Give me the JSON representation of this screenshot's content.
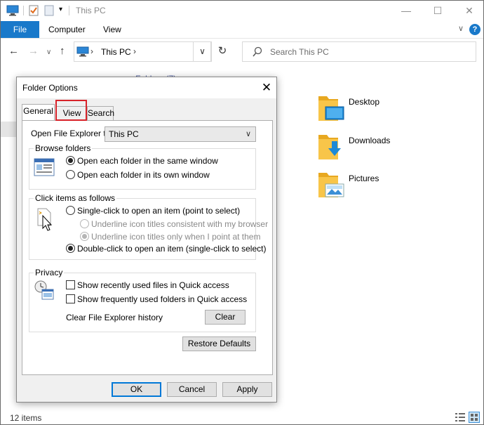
{
  "window": {
    "title": "This PC",
    "controls": {
      "minimize": "—",
      "maximize": "☐",
      "close": "✕"
    }
  },
  "ribbon": {
    "file": "File",
    "tabs": [
      "Computer",
      "View"
    ],
    "expand": "∨",
    "help": "?"
  },
  "nav": {
    "back": "←",
    "forward": "→",
    "recent": "∨",
    "up": "↑",
    "address": "This PC",
    "address_chevron": "›",
    "dropdown": "∨",
    "refresh": "↻",
    "search_placeholder": "Search This PC"
  },
  "content": {
    "group_header": "∨ Folders (7)",
    "folders": [
      {
        "label": "Desktop"
      },
      {
        "label": "Downloads"
      },
      {
        "label": "Pictures"
      }
    ]
  },
  "status": {
    "items": "12 items"
  },
  "dialog": {
    "title": "Folder Options",
    "close": "✕",
    "tabs": [
      "General",
      "View",
      "Search"
    ],
    "open_to_label": "Open File Explorer to:",
    "open_to_value": "This PC",
    "browse": {
      "title": "Browse folders",
      "options": [
        "Open each folder in the same window",
        "Open each folder in its own window"
      ]
    },
    "click": {
      "title": "Click items as follows",
      "single": "Single-click to open an item (point to select)",
      "underline_browser": "Underline icon titles consistent with my browser",
      "underline_point": "Underline icon titles only when I point at them",
      "double": "Double-click to open an item (single-click to select)"
    },
    "privacy": {
      "title": "Privacy",
      "recent_files": "Show recently used files in Quick access",
      "frequent_folders": "Show frequently used folders in Quick access",
      "clear_label": "Clear File Explorer history",
      "clear_button": "Clear"
    },
    "restore_defaults": "Restore Defaults",
    "ok": "OK",
    "cancel": "Cancel",
    "apply": "Apply"
  },
  "colors": {
    "accent": "#1979ca",
    "highlight": "#d8232a",
    "folder": "#f8c549"
  }
}
